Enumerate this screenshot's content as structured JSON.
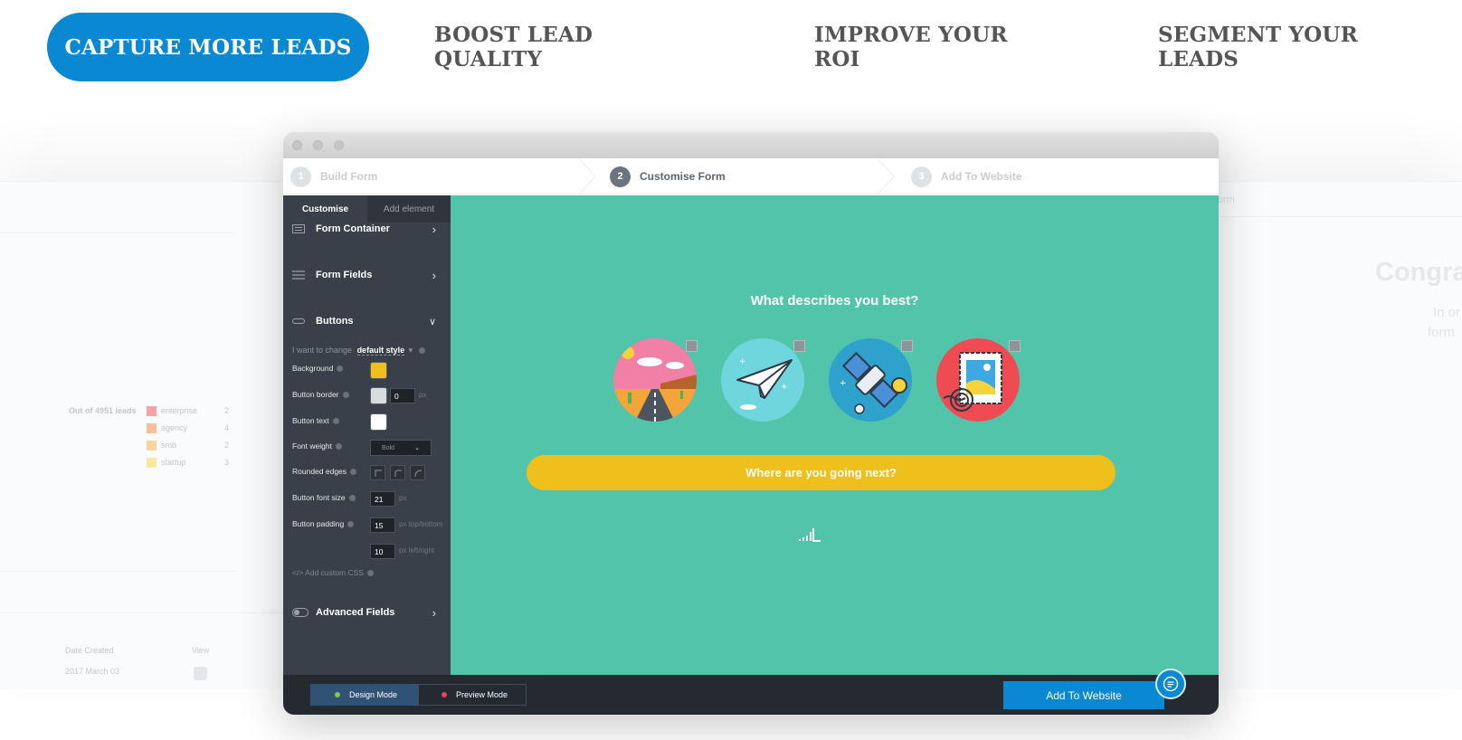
{
  "tabs": [
    {
      "label": "CAPTURE MORE LEADS",
      "active": true
    },
    {
      "label": "BOOST LEAD QUALITY",
      "active": false
    },
    {
      "label": "IMPROVE YOUR ROI",
      "active": false
    },
    {
      "label": "SEGMENT YOUR LEADS",
      "active": false
    }
  ],
  "colors": {
    "accent": "#0a88d2",
    "canvas": "#52c4a9",
    "cta": "#efbf1b",
    "sidebar": "#3a4049"
  },
  "ghost_left": {
    "leads_label": "Out of 4951 leads",
    "legend": [
      {
        "label": "enterprise",
        "count": "2",
        "color": "#f7a3a3"
      },
      {
        "label": "agency",
        "count": "4",
        "color": "#f9bf9b"
      },
      {
        "label": "smb",
        "count": "2",
        "color": "#fbd59b"
      },
      {
        "label": "startup",
        "count": "3",
        "color": "#fbe9a0"
      }
    ],
    "col_date": "Date Created",
    "col_view": "View",
    "row_date": "2017 March 03"
  },
  "ghost_right": {
    "step": "d Form",
    "heading": "Congra",
    "line1": "In or",
    "line2": "form"
  },
  "steps": [
    {
      "num": "1",
      "label": "Build Form",
      "state": "inactive"
    },
    {
      "num": "2",
      "label": "Customise Form",
      "state": "current"
    },
    {
      "num": "3",
      "label": "Add To Website",
      "state": "inactive"
    }
  ],
  "sidebar": {
    "tab_customise": "Customise",
    "tab_add": "Add element",
    "sections": {
      "form_container": "Form Container",
      "form_fields": "Form Fields",
      "buttons": "Buttons",
      "advanced": "Advanced Fields"
    },
    "change_label": "I want to change",
    "change_value": "default style",
    "props": {
      "background": "Background",
      "border": "Button border",
      "text": "Button text",
      "font_weight": "Font weight",
      "rounded": "Rounded edges",
      "font_size": "Button font size",
      "padding": "Button padding",
      "custom_css": "</> Add custom CSS"
    },
    "values": {
      "background_color": "#efbf1b",
      "border_color": "#d9dcdf",
      "text_color": "#ffffff",
      "border_width": "0",
      "font_weight": "Bold",
      "font_size": "21",
      "padding_tb": "15",
      "padding_lr": "10"
    },
    "units": {
      "px": "px",
      "tb": "px top/bottom",
      "lr": "px left/right"
    }
  },
  "canvas": {
    "question": "What describes you best?",
    "options": [
      "road-trip",
      "paper-plane",
      "satellite",
      "postage-stamp"
    ],
    "cta": "Where are you going next?"
  },
  "footer": {
    "design_mode": "Design Mode",
    "preview_mode": "Preview Mode",
    "add_to_website": "Add To Website"
  }
}
